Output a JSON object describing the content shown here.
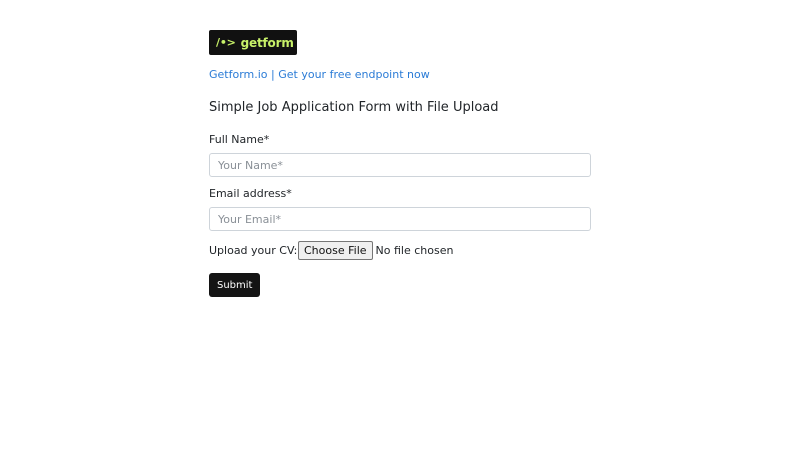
{
  "brand": {
    "logo_glyph": "/•>",
    "logo_text": "getform",
    "colors": {
      "logo_bg": "#111111",
      "logo_text": "#c8f169"
    }
  },
  "header": {
    "link_text": "Getform.io | Get your free endpoint now",
    "link_color": "#2a7bd6"
  },
  "form": {
    "title": "Simple Job Application Form with File Upload",
    "name_label": "Full Name*",
    "name_placeholder": "Your Name*",
    "name_value": "",
    "email_label": "Email address*",
    "email_placeholder": "Your Email*",
    "email_value": "",
    "cv_label": "Upload your CV:",
    "choose_file_label": "Choose File",
    "file_status": "No file chosen",
    "submit_label": "Submit"
  }
}
